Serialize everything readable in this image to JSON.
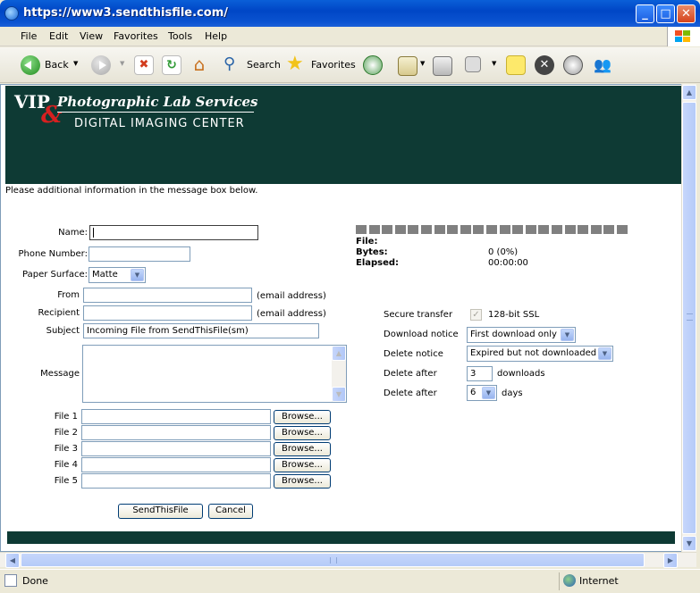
{
  "window": {
    "title": "https://www3.sendthisfile.com/"
  },
  "menu": [
    "File",
    "Edit",
    "View",
    "Favorites",
    "Tools",
    "Help"
  ],
  "toolbar": {
    "back": "Back",
    "search": "Search",
    "favorites": "Favorites"
  },
  "header": {
    "logo_vip": "VIP",
    "logo_amp": "&",
    "logo_line1": "Photographic Lab Services",
    "logo_line2": "DIGITAL IMAGING CENTER"
  },
  "form": {
    "intro": "Please additional information in the message box below.",
    "name_label": "Name:",
    "name_value": "",
    "phone_label": "Phone Number:",
    "phone_value": "",
    "surface_label": "Paper Surface:",
    "surface_value": "Matte",
    "from_label": "From",
    "from_hint": "(email address)",
    "recipient_label": "Recipient",
    "recipient_hint": "(email address)",
    "subject_label": "Subject",
    "subject_value": "Incoming File from SendThisFile(sm)",
    "message_label": "Message",
    "files": [
      {
        "label": "File 1",
        "button": "Browse..."
      },
      {
        "label": "File 2",
        "button": "Browse..."
      },
      {
        "label": "File 3",
        "button": "Browse..."
      },
      {
        "label": "File 4",
        "button": "Browse..."
      },
      {
        "label": "File 5",
        "button": "Browse..."
      }
    ],
    "send_button": "SendThisFile",
    "cancel_button": "Cancel"
  },
  "progress": {
    "file_label": "File:",
    "bytes_label": "Bytes:",
    "bytes_value": "0 (0%)",
    "elapsed_label": "Elapsed:",
    "elapsed_value": "00:00:00",
    "fraction": 0
  },
  "options": {
    "secure_label": "Secure transfer",
    "secure_value": "128-bit SSL",
    "download_notice_label": "Download notice",
    "download_notice_value": "First download only",
    "delete_notice_label": "Delete notice",
    "delete_notice_value": "Expired but not downloaded",
    "delete_after_downloads_label": "Delete after",
    "delete_after_downloads_value": "3",
    "downloads_unit": "downloads",
    "delete_after_days_label": "Delete after",
    "delete_after_days_value": "6",
    "days_unit": "days"
  },
  "status": {
    "text": "Done",
    "zone": "Internet"
  },
  "colors": {
    "header_bg": "#0e3a34",
    "accent_red": "#d62020",
    "titlebar": "#0046c6"
  }
}
